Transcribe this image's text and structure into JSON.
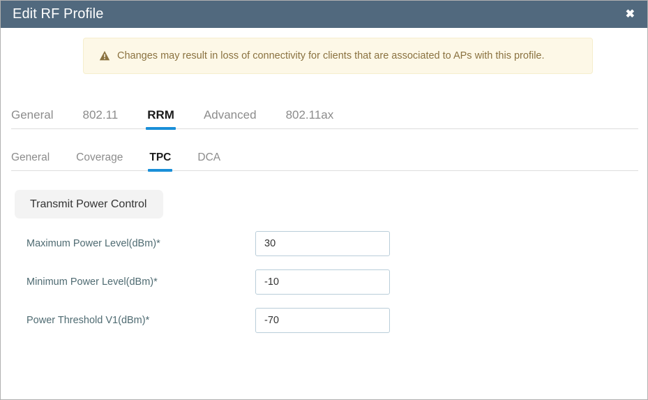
{
  "titlebar": {
    "title": "Edit RF Profile",
    "close_label": "✖",
    "close_icon": "close-icon",
    "background": "#51697e"
  },
  "banner": {
    "icon": "warning-triangle-icon",
    "text": "Changes may result in loss of connectivity for clients that are associated to APs with this profile.",
    "background": "#fdf8e7",
    "text_color": "#8a7240"
  },
  "primary_tabs": {
    "active_color": "#1a8fd8",
    "items": [
      {
        "label": "General",
        "active": false
      },
      {
        "label": "802.11",
        "active": false
      },
      {
        "label": "RRM",
        "active": true
      },
      {
        "label": "Advanced",
        "active": false
      },
      {
        "label": "802.11ax",
        "active": false
      }
    ]
  },
  "secondary_tabs": {
    "active_color": "#1a8fd8",
    "items": [
      {
        "label": "General",
        "active": false
      },
      {
        "label": "Coverage",
        "active": false
      },
      {
        "label": "TPC",
        "active": true
      },
      {
        "label": "DCA",
        "active": false
      }
    ]
  },
  "section": {
    "title": "Transmit Power Control"
  },
  "form": {
    "fields": [
      {
        "label": "Maximum Power Level(dBm)*",
        "value": "30",
        "placeholder": ""
      },
      {
        "label": "Minimum Power Level(dBm)*",
        "value": "-10",
        "placeholder": ""
      },
      {
        "label": "Power Threshold V1(dBm)*",
        "value": "-70",
        "placeholder": ""
      }
    ]
  }
}
